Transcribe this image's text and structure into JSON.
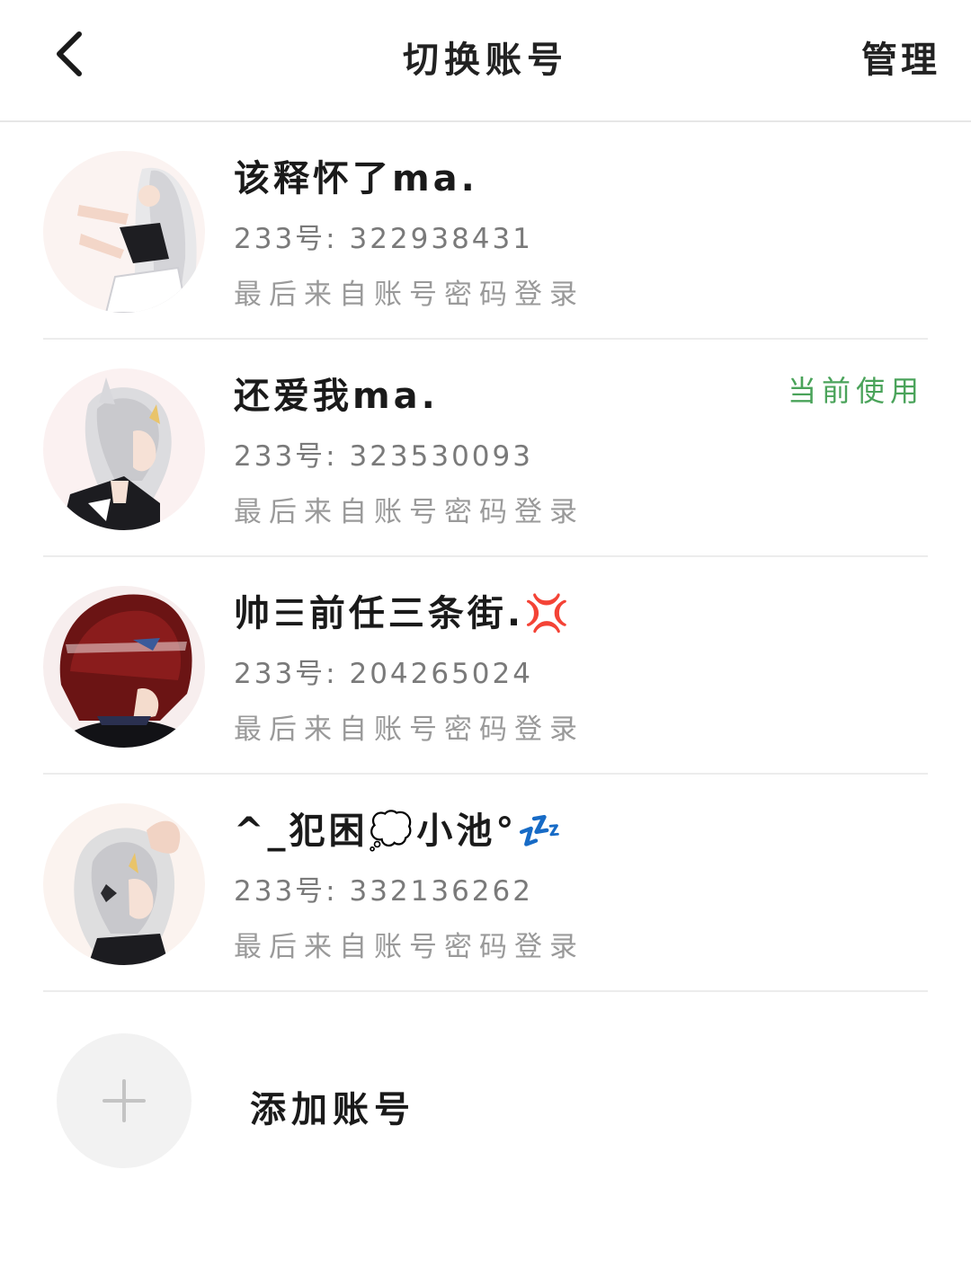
{
  "header": {
    "title": "切换账号",
    "manage_label": "管理",
    "back_icon": "chevron-left-icon"
  },
  "accounts": [
    {
      "nickname": "该释怀了ma.",
      "uid_label": "233号: 322938431",
      "login_source": "最后来自账号密码登录",
      "is_current": false,
      "avatar": "anime-girl-silver-hair-avatar"
    },
    {
      "nickname": "还爱我ma.",
      "uid_label": "233号: 323530093",
      "login_source": "最后来自账号密码登录",
      "is_current": true,
      "current_label": "当前使用",
      "avatar": "anime-girl-silver-hair-profile-avatar"
    },
    {
      "nickname": "帅☰前任三条街.",
      "nickname_emoji": "💢",
      "uid_label": "233号: 204265024",
      "login_source": "最后来自账号密码登录",
      "is_current": false,
      "avatar": "anime-boy-red-hair-avatar"
    },
    {
      "nickname": "^_犯困",
      "nickname_emoji_1": "💭",
      "nickname_suffix": "小池°",
      "nickname_emoji_2": "💤",
      "uid_label": "233号: 332136262",
      "login_source": "最后来自账号密码登录",
      "is_current": false,
      "avatar": "anime-girl-silver-hair-head-pat-avatar"
    }
  ],
  "add_account": {
    "label": "添加账号",
    "icon": "plus-icon"
  },
  "colors": {
    "current_badge": "#4aa35a",
    "divider": "#ececec",
    "secondary_text": "#7a7a7a"
  }
}
